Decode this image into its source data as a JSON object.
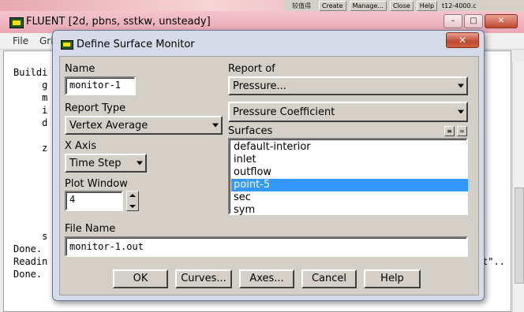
{
  "top_strip": {
    "label_cn": "较值得",
    "buttons": [
      "Create",
      "Manage...",
      "Close",
      "Help"
    ],
    "file_label": "t12-4000.c"
  },
  "main_window": {
    "title": "FLUENT  [2d, pbns, sstkw, unsteady]",
    "controls": [
      "–",
      "□",
      "✕"
    ],
    "menu": [
      "File",
      "Gri"
    ],
    "console_lines": {
      "l1": "Buildi",
      "l2": "     g",
      "l3": "     m",
      "l4": "     i",
      "l5": "     d",
      "l6": "     z",
      "l7": "     s",
      "l8": "Done.",
      "l9": "Readin",
      "l9_right": "t\"..",
      "l10": "Done."
    }
  },
  "dialog": {
    "title": "Define Surface Monitor",
    "close_symbol": "✕",
    "name_label": "Name",
    "name_value": "monitor-1",
    "report_type_label": "Report Type",
    "report_type_value": "Vertex Average",
    "x_axis_label": "X Axis",
    "x_axis_value": "Time Step",
    "plot_window_label": "Plot Window",
    "plot_window_value": "4",
    "report_of_label": "Report of",
    "report_of_value": "Pressure...",
    "report_of_sub_value": "Pressure Coefficient",
    "surfaces_label": "Surfaces",
    "surfaces": [
      "default-interior",
      "inlet",
      "outflow",
      "point-5",
      "sec",
      "sym"
    ],
    "selected_surface": "point-5",
    "file_name_label": "File Name",
    "file_name_value": "monitor-1.out",
    "buttons": {
      "ok": "OK",
      "curves": "Curves...",
      "axes": "Axes...",
      "cancel": "Cancel",
      "help": "Help"
    }
  }
}
